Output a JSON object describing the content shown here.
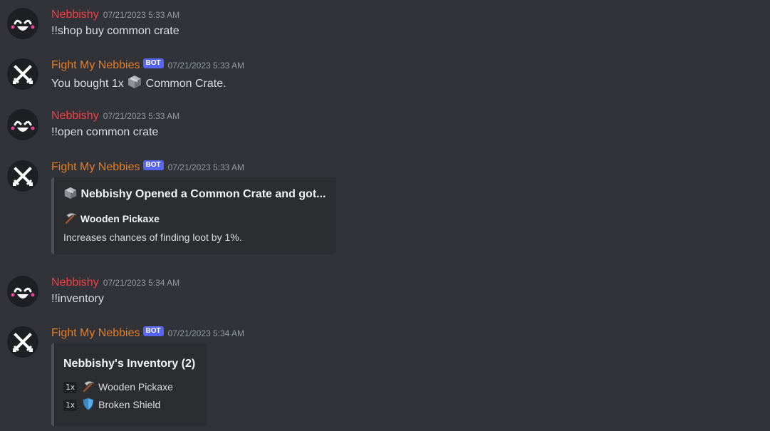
{
  "users": {
    "human": {
      "name": "Nebbishy",
      "color": "#f23f42"
    },
    "bot": {
      "name": "Fight My Nebbies",
      "color": "#e67e22",
      "tag": "BOT"
    }
  },
  "messages": [
    {
      "author": "Nebbishy",
      "timestamp": "07/21/2023 5:33 AM",
      "text": "!!shop buy common crate"
    },
    {
      "author": "Fight My Nebbies",
      "bot_tag": "BOT",
      "timestamp": "07/21/2023 5:33 AM",
      "text_before": "You bought 1x",
      "icon": "crate-icon",
      "text_after": "Common Crate."
    },
    {
      "author": "Nebbishy",
      "timestamp": "07/21/2023 5:33 AM",
      "text": "!!open common crate"
    },
    {
      "author": "Fight My Nebbies",
      "bot_tag": "BOT",
      "timestamp": "07/21/2023 5:33 AM",
      "embed": {
        "title_icon": "crate-icon",
        "title": "Nebbishy Opened a Common Crate and got...",
        "field_icon": "pickaxe-icon",
        "field_name": "Wooden Pickaxe",
        "field_value": "Increases chances of finding loot by 1%."
      }
    },
    {
      "author": "Nebbishy",
      "timestamp": "07/21/2023 5:34 AM",
      "text": "!!inventory"
    },
    {
      "author": "Fight My Nebbies",
      "bot_tag": "BOT",
      "timestamp": "07/21/2023 5:34 AM",
      "embed": {
        "title": "Nebbishy's Inventory (2)",
        "items": [
          {
            "qty": "1x",
            "icon": "pickaxe-icon",
            "name": "Wooden Pickaxe"
          },
          {
            "qty": "1x",
            "icon": "shield-icon",
            "name": "Broken Shield"
          }
        ]
      }
    }
  ]
}
